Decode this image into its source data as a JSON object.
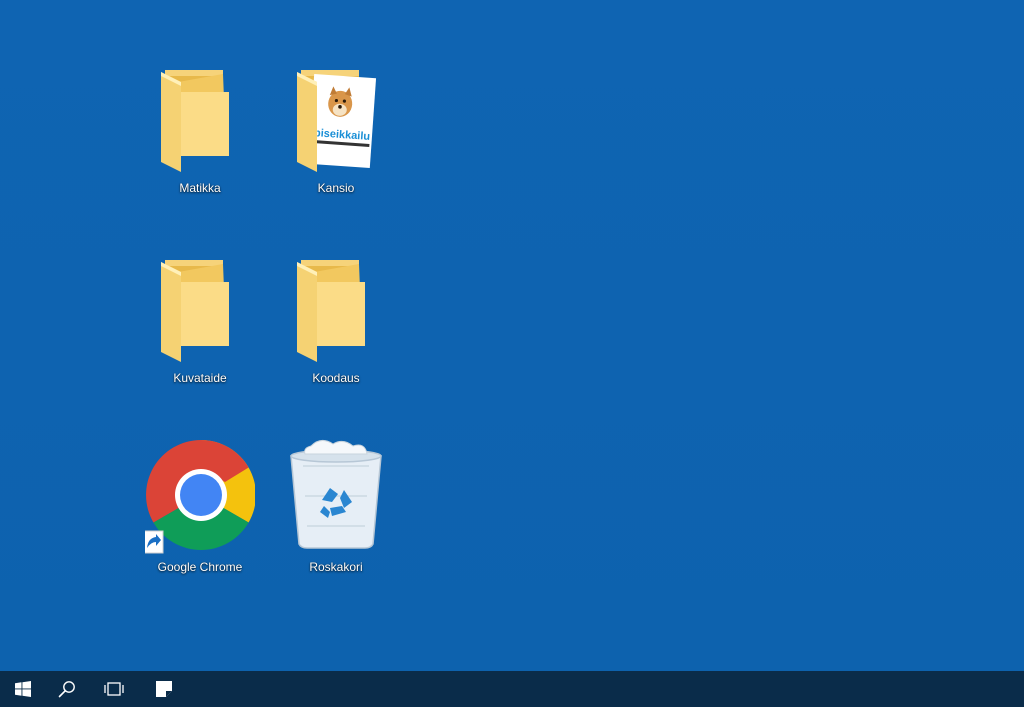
{
  "desktop": {
    "icons": [
      {
        "label": "Matikka",
        "type": "folder",
        "icon": "folder-icon"
      },
      {
        "label": "Kansio",
        "type": "folder",
        "icon": "folder-with-image-icon"
      },
      {
        "label": "Kuvataide",
        "type": "folder",
        "icon": "folder-icon"
      },
      {
        "label": "Koodaus",
        "type": "folder",
        "icon": "folder-icon"
      },
      {
        "label": "Google Chrome",
        "type": "shortcut",
        "icon": "chrome-icon"
      },
      {
        "label": "Roskakori",
        "type": "recycle-bin",
        "icon": "recycle-bin-icon"
      }
    ],
    "kansio_thumbnail_text": "piseikkailu"
  },
  "taskbar": {
    "buttons": [
      {
        "icon": "windows-start-icon"
      },
      {
        "icon": "search-icon"
      },
      {
        "icon": "task-view-icon"
      },
      {
        "icon": "sticky-notes-icon"
      }
    ]
  },
  "colors": {
    "desktop_background": "#0e63b0",
    "taskbar_background": "#0a2c4a",
    "folder_yellow": "#f8d675",
    "chrome_red": "#db4437",
    "chrome_yellow": "#f4c20d",
    "chrome_green": "#0f9d58",
    "chrome_blue": "#4285f4"
  }
}
